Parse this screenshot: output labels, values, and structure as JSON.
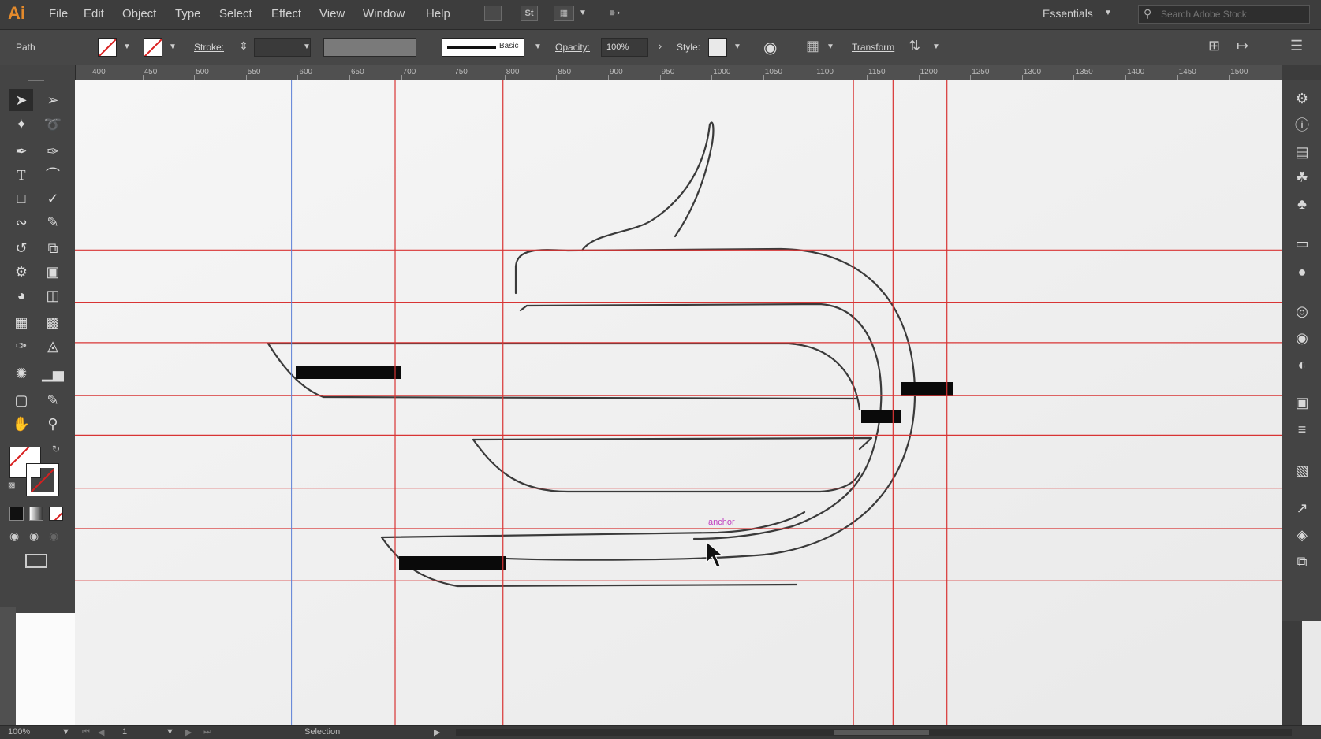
{
  "app": {
    "logo": "Ai"
  },
  "menu": [
    "File",
    "Edit",
    "Object",
    "Type",
    "Select",
    "Effect",
    "View",
    "Window",
    "Help"
  ],
  "menubar_icons": {
    "bridge": "bridge-icon",
    "stock": "St",
    "arrange": "arrange-documents-icon",
    "gpu": "gpu-performance-icon"
  },
  "workspace": {
    "label": "Essentials"
  },
  "search": {
    "placeholder": "Search Adobe Stock"
  },
  "control": {
    "selection_label": "Path",
    "stroke_label": "Stroke:",
    "brush_label": "Basic",
    "opacity_label": "Opacity:",
    "opacity_value": "100%",
    "style_label": "Style:",
    "transform_label": "Transform"
  },
  "ruler": {
    "ticks": [
      "400",
      "450",
      "500",
      "550",
      "600",
      "650",
      "700",
      "750",
      "800",
      "850",
      "900",
      "950",
      "1000",
      "1050",
      "1100",
      "1150",
      "1200",
      "1250",
      "1300",
      "1350",
      "1400",
      "1450",
      "1500"
    ]
  },
  "tools": [
    "selection-tool",
    "direct-selection-tool",
    "magic-wand-tool",
    "lasso-tool",
    "pen-tool",
    "curvature-tool",
    "type-tool",
    "arc-tool",
    "rectangle-tool",
    "paintbrush-tool",
    "shaper-tool",
    "eraser-tool",
    "rotate-tool",
    "scale-tool",
    "warp-tool",
    "free-transform-tool",
    "shape-builder-tool",
    "perspective-grid-tool",
    "mesh-tool",
    "gradient-tool",
    "eyedropper-tool",
    "blend-tool",
    "symbol-sprayer-tool",
    "column-graph-tool",
    "artboard-tool",
    "slice-tool",
    "hand-tool",
    "zoom-tool"
  ],
  "dock_icons": [
    "properties-icon",
    "info-icon",
    "libraries-icon",
    "puppet-icon",
    "club-icon",
    "color-guide-icon",
    "swatches-icon",
    "appearance-icon",
    "graphic-styles-icon",
    "transparency-icon",
    "transform-icon",
    "align-icon",
    "pathfinder-icon",
    "export-icon",
    "layers-icon",
    "artboards-icon"
  ],
  "canvas": {
    "hint_label": "anchor",
    "guides_h": [
      297,
      359,
      407,
      470,
      517,
      580,
      628,
      690
    ],
    "guides_v": [
      469,
      597,
      1013,
      1060,
      1124
    ],
    "guide_blue": 346
  },
  "status": {
    "zoom": "100%",
    "artboard_number": "1",
    "tool_name": "Selection"
  }
}
